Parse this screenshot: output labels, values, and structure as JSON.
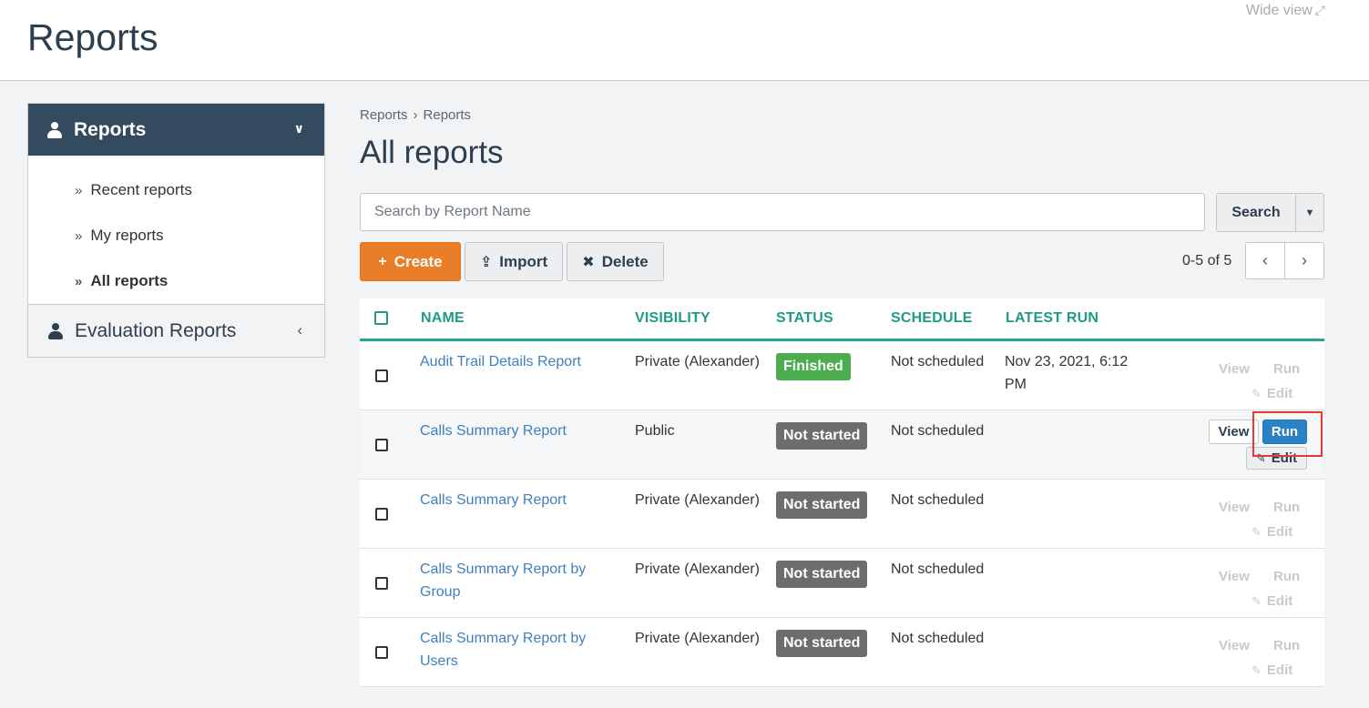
{
  "header": {
    "title": "Reports",
    "wide_view": "Wide view"
  },
  "sidebar": {
    "head_label": "Reports",
    "items": [
      {
        "label": "Recent reports"
      },
      {
        "label": "My reports"
      },
      {
        "label": "All reports"
      }
    ],
    "section_label": "Evaluation Reports"
  },
  "breadcrumb": [
    "Reports",
    "Reports"
  ],
  "main": {
    "heading": "All reports",
    "search_placeholder": "Search by Report Name",
    "search_label": "Search",
    "create_label": "Create",
    "import_label": "Import",
    "delete_label": "Delete",
    "pager_text": "0-5 of 5"
  },
  "table": {
    "columns": [
      "NAME",
      "VISIBILITY",
      "STATUS",
      "SCHEDULE",
      "LATEST RUN"
    ],
    "action_labels": {
      "view": "View",
      "run": "Run",
      "edit": "Edit"
    },
    "rows": [
      {
        "name": "Audit Trail Details Report",
        "visibility": "Private (Alexander)",
        "status": "Finished",
        "schedule": "Not scheduled",
        "latest_run": "Nov 23, 2021, 6:12 PM"
      },
      {
        "name": "Calls Summary Report",
        "visibility": "Public",
        "status": "Not started",
        "schedule": "Not scheduled",
        "latest_run": ""
      },
      {
        "name": "Calls Summary Report",
        "visibility": "Private (Alexander)",
        "status": "Not started",
        "schedule": "Not scheduled",
        "latest_run": ""
      },
      {
        "name": "Calls Summary Report by Group",
        "visibility": "Private (Alexander)",
        "status": "Not started",
        "schedule": "Not scheduled",
        "latest_run": ""
      },
      {
        "name": "Calls Summary Report by Users",
        "visibility": "Private (Alexander)",
        "status": "Not started",
        "schedule": "Not scheduled",
        "latest_run": ""
      }
    ]
  },
  "colors": {
    "accent_teal": "#1f9a84",
    "create_orange": "#ea7d27",
    "run_blue": "#2a81c6",
    "finished_green": "#4cad4f",
    "sidebar_navy": "#344a5e"
  },
  "icons": [
    "user-icon",
    "chevron-down-icon",
    "chevron-left-icon",
    "double-chevron-right-icon",
    "plus-icon",
    "upload-icon",
    "close-icon",
    "caret-down-icon",
    "expand-icon",
    "edit-icon"
  ]
}
